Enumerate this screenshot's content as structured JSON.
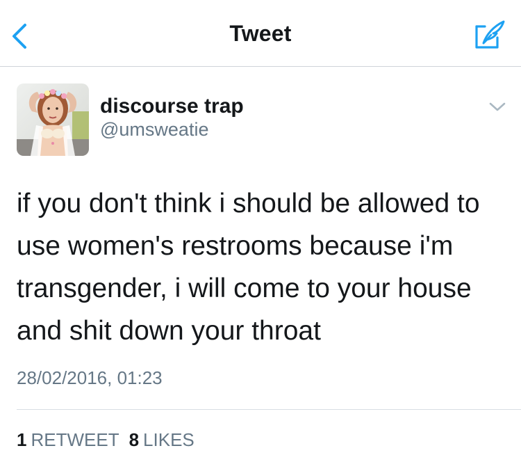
{
  "nav": {
    "title": "Tweet",
    "back_icon": "chevron-left-icon",
    "compose_icon": "compose-quill-icon",
    "accent_color": "#1da1f2"
  },
  "tweet": {
    "author": {
      "display_name": "discourse trap",
      "handle": "@umsweatie",
      "avatar": "profile-photo"
    },
    "text_lines": [
      "if you don't think i should be allowed to",
      "use women's restrooms because i'm",
      "transgender, i will come to your house",
      "and shit down your throat"
    ],
    "timestamp": "28/02/2016, 01:23",
    "stats": {
      "retweets_count": "1",
      "retweets_label": "RETWEET",
      "likes_count": "8",
      "likes_label": "LIKES"
    },
    "menu_icon": "chevron-down-icon"
  }
}
